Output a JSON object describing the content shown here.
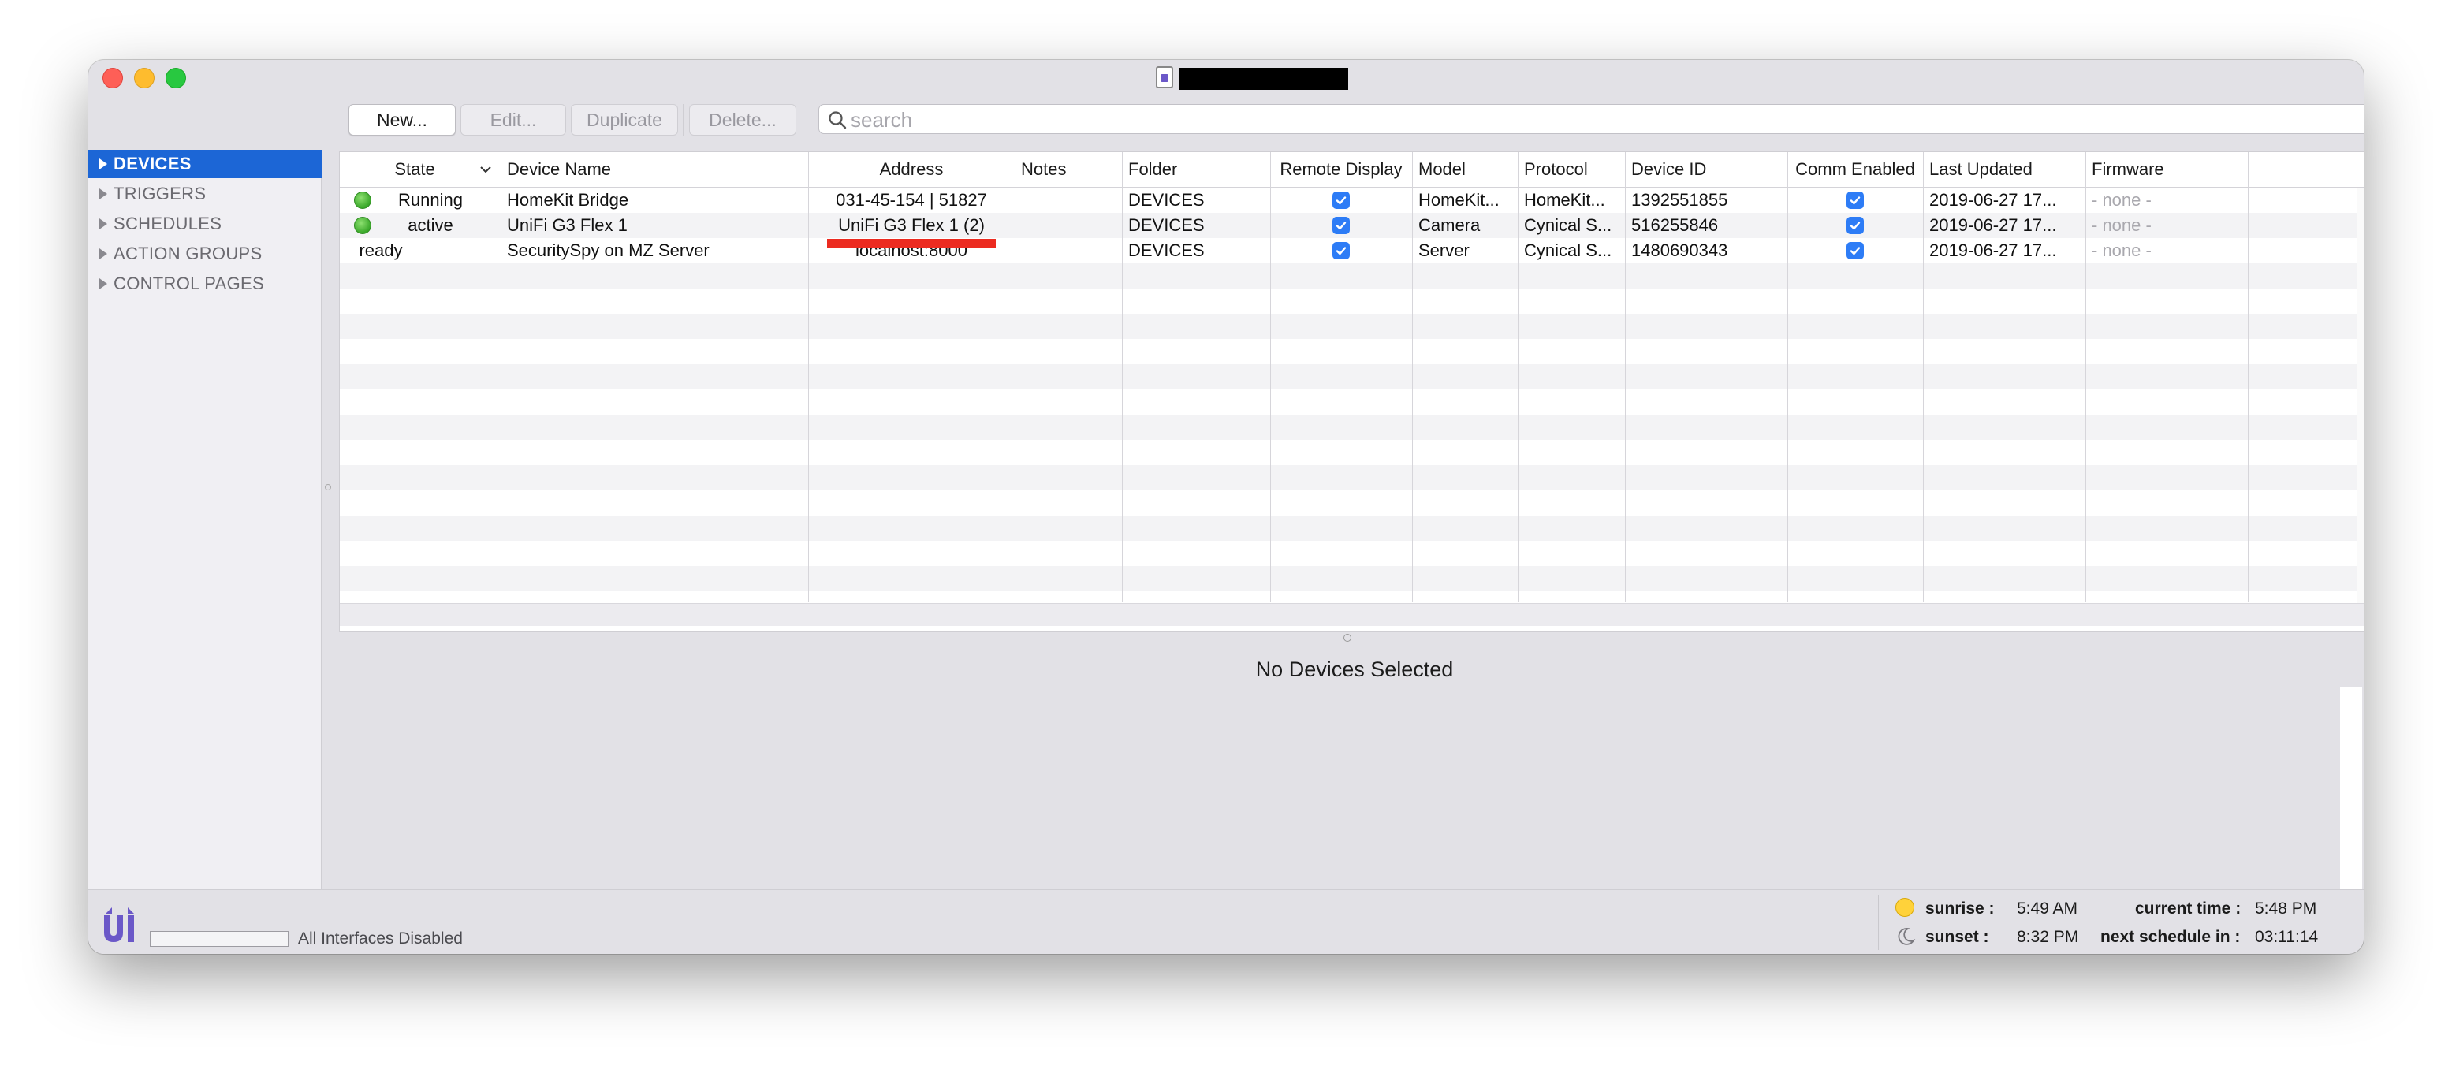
{
  "toolbar": {
    "new_label": "New...",
    "edit_label": "Edit...",
    "duplicate_label": "Duplicate",
    "delete_label": "Delete..."
  },
  "search": {
    "placeholder": "search",
    "value": ""
  },
  "sidebar": {
    "items": [
      {
        "label": "DEVICES",
        "selected": true
      },
      {
        "label": "TRIGGERS",
        "selected": false
      },
      {
        "label": "SCHEDULES",
        "selected": false
      },
      {
        "label": "ACTION GROUPS",
        "selected": false
      },
      {
        "label": "CONTROL PAGES",
        "selected": false
      }
    ]
  },
  "table": {
    "columns": [
      "State",
      "Device Name",
      "Address",
      "Notes",
      "Folder",
      "Remote Display",
      "Model",
      "Protocol",
      "Device ID",
      "Comm Enabled",
      "Last Updated",
      "Firmware"
    ],
    "rows": [
      {
        "state": "Running",
        "state_indicator": "green",
        "name": "HomeKit Bridge",
        "address": "031-45-154 | 51827",
        "notes": "",
        "folder": "DEVICES",
        "remote_display": true,
        "model": "HomeKit...",
        "protocol": "HomeKit...",
        "device_id": "1392551855",
        "comm_enabled": true,
        "last_updated": "2019-06-27 17...",
        "firmware": "- none -"
      },
      {
        "state": "active",
        "state_indicator": "green",
        "name": "UniFi G3 Flex 1",
        "address": "UniFi G3 Flex 1 (2)",
        "notes": "",
        "folder": "DEVICES",
        "remote_display": true,
        "model": "Camera",
        "protocol": "Cynical S...",
        "device_id": "516255846",
        "comm_enabled": true,
        "last_updated": "2019-06-27 17...",
        "firmware": "- none -"
      },
      {
        "state": "ready",
        "state_indicator": "none",
        "name": "SecuritySpy on MZ Server",
        "address": "localhost:8000",
        "notes": "",
        "folder": "DEVICES",
        "remote_display": true,
        "model": "Server",
        "protocol": "Cynical S...",
        "device_id": "1480690343",
        "comm_enabled": true,
        "last_updated": "2019-06-27 17...",
        "firmware": "- none -"
      }
    ]
  },
  "detail": {
    "empty_text": "No Devices Selected"
  },
  "status": {
    "interfaces_text": "All Interfaces Disabled",
    "sunrise_label": "sunrise :",
    "sunrise_value": "5:49 AM",
    "sunset_label": "sunset :",
    "sunset_value": "8:32 PM",
    "current_time_label": "current time :",
    "current_time_value": "5:48 PM",
    "next_schedule_label": "next schedule in :",
    "next_schedule_value": "03:11:14"
  },
  "colors": {
    "selection": "#1c66d6",
    "checkbox": "#2d7cf6",
    "status_green": "#3aa82a",
    "highlight_red": "#ec2b20",
    "brand_purple": "#6b58c8"
  }
}
